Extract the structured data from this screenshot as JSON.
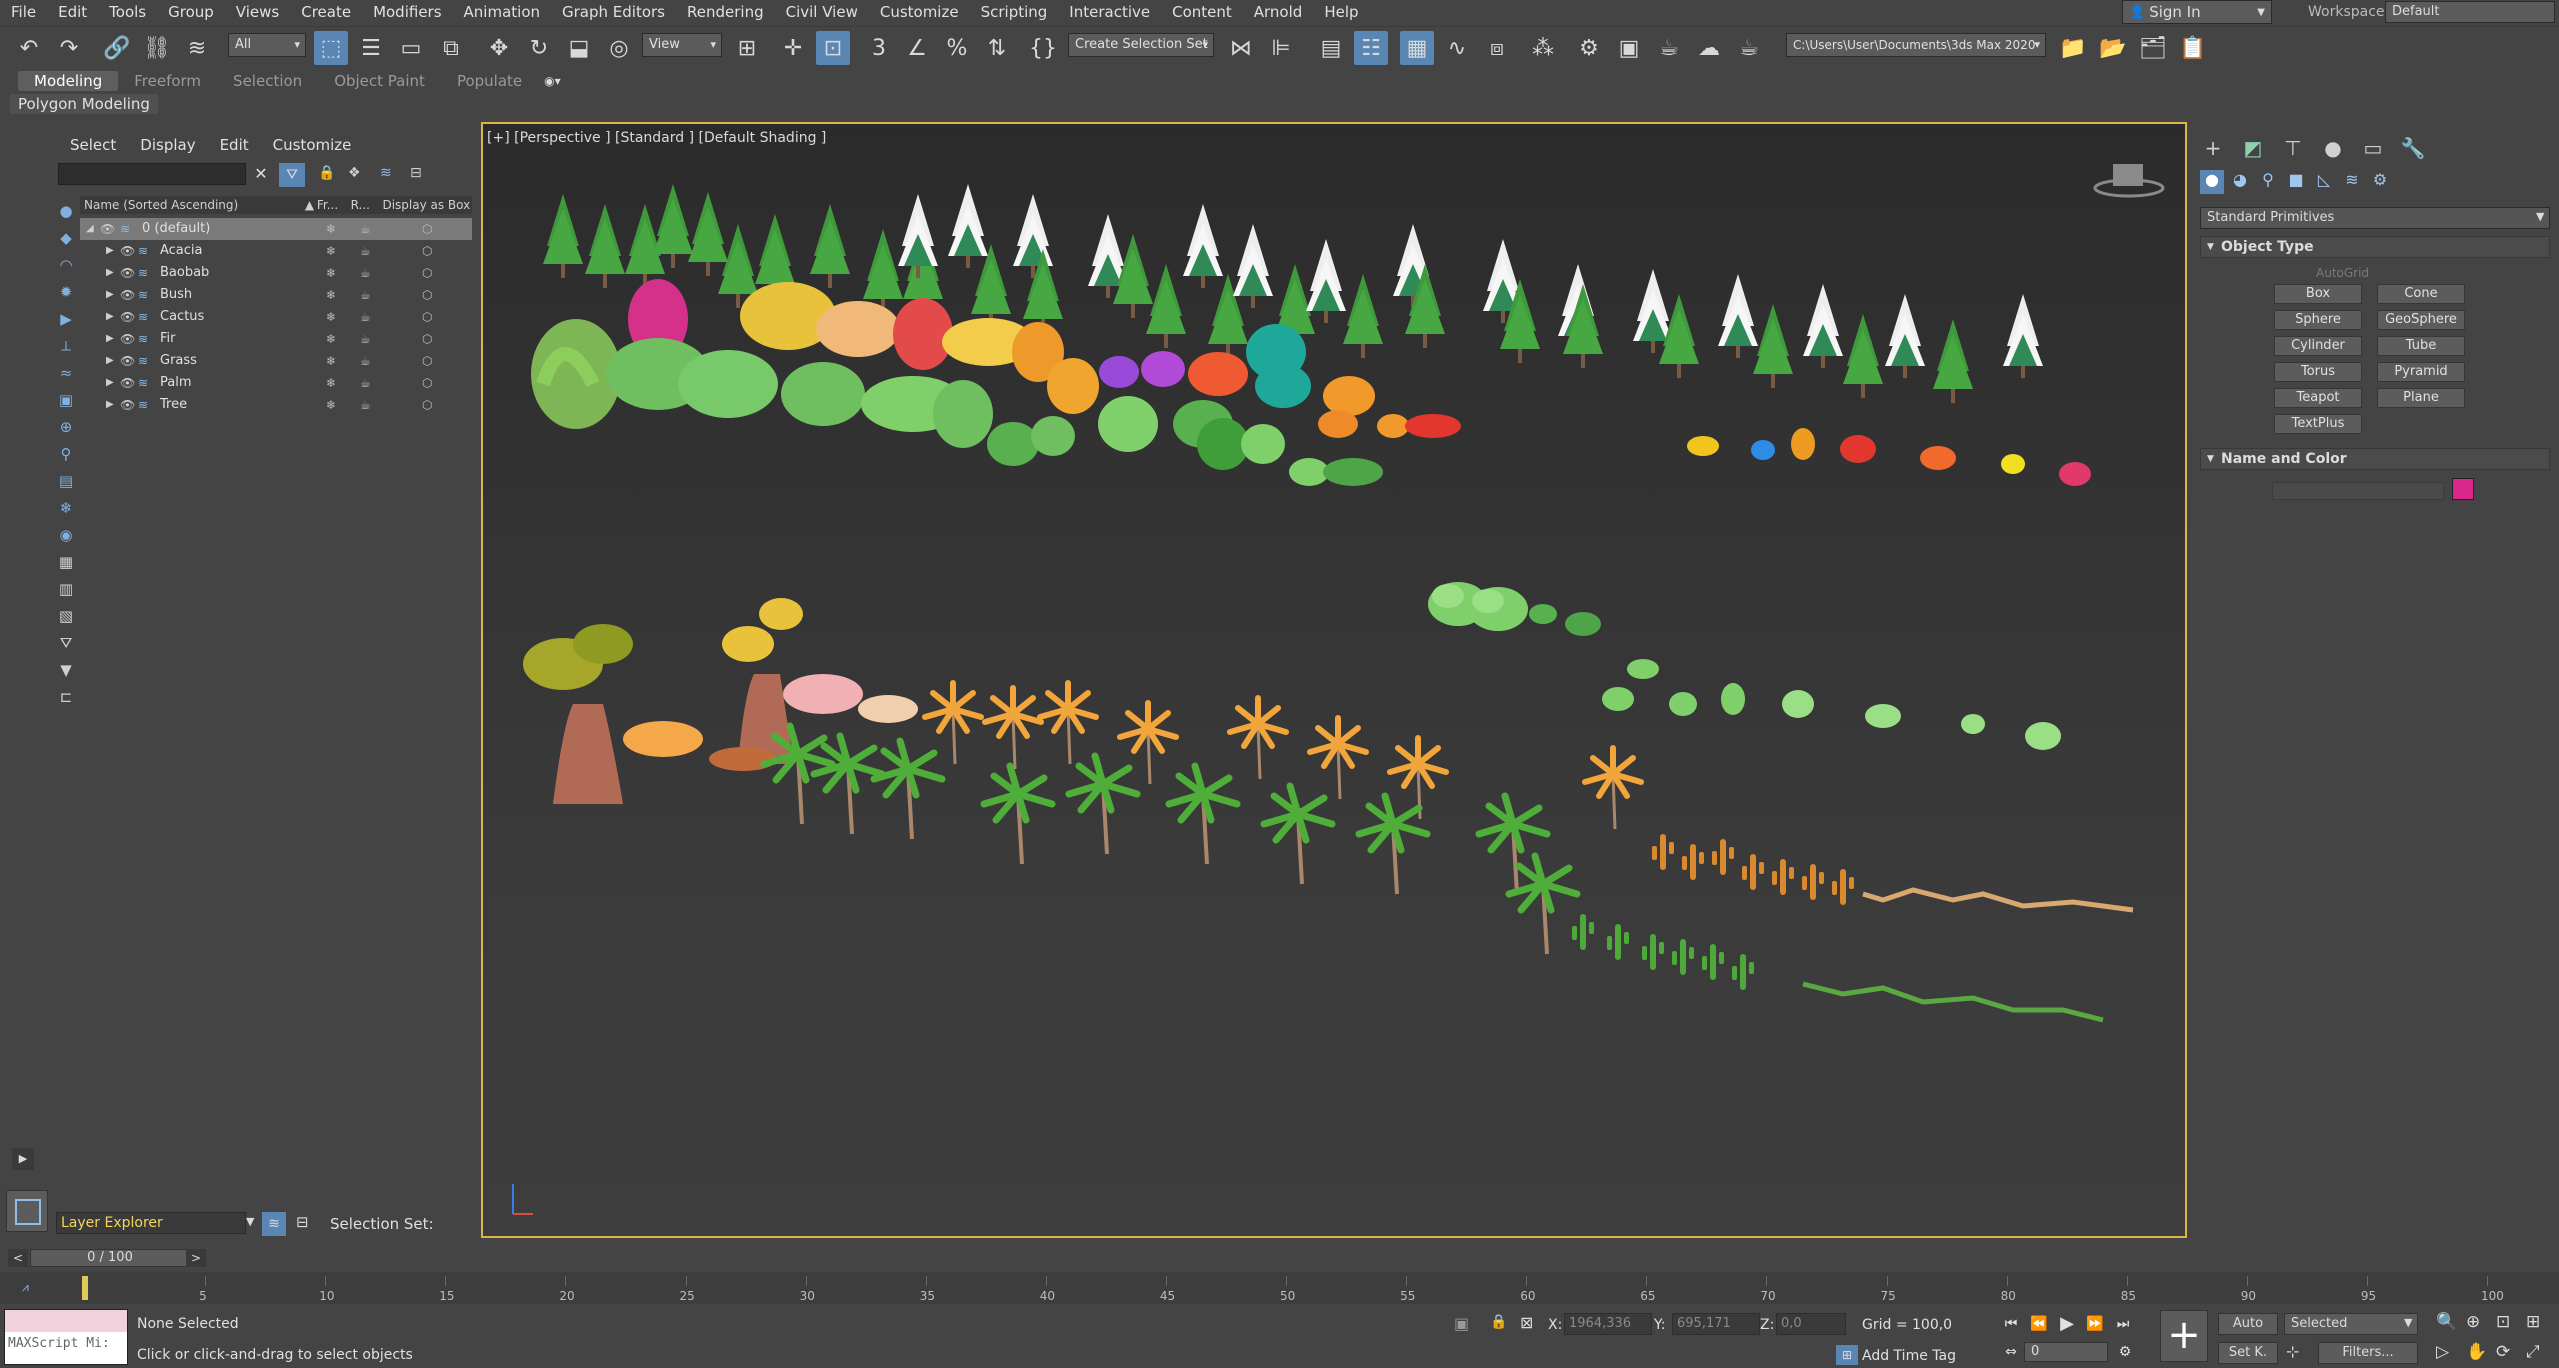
{
  "menu": [
    "File",
    "Edit",
    "Tools",
    "Group",
    "Views",
    "Create",
    "Modifiers",
    "Animation",
    "Graph Editors",
    "Rendering",
    "Civil View",
    "Customize",
    "Scripting",
    "Interactive",
    "Content",
    "Arnold",
    "Help"
  ],
  "account": {
    "sign_in": "Sign In",
    "workspaces_label": "Workspaces:",
    "workspace": "Default"
  },
  "toolbar": {
    "selection_filter": "All",
    "reference_coord": "View",
    "selection_set": "Create Selection Set",
    "project_path": "C:\\Users\\User\\Documents\\3ds Max 2020"
  },
  "ribbon": {
    "tabs": [
      "Modeling",
      "Freeform",
      "Selection",
      "Object Paint",
      "Populate"
    ],
    "active_tab": "Modeling",
    "sub_tab": "Polygon Modeling"
  },
  "explorer": {
    "menu": [
      "Select",
      "Display",
      "Edit",
      "Customize"
    ],
    "columns": {
      "name": "Name (Sorted Ascending)",
      "freeze": "Fr...",
      "render": "R...",
      "box": "Display as Box"
    },
    "root": "0 (default)",
    "layers": [
      "Acacia",
      "Baobab",
      "Bush",
      "Cactus",
      "Fir",
      "Grass",
      "Palm",
      "Tree"
    ],
    "bottom_selector": "Layer Explorer",
    "selection_set_label": "Selection Set:"
  },
  "viewport": {
    "label": "[+] [Perspective ] [Standard ] [Default Shading ]"
  },
  "command_panel": {
    "category": "Standard Primitives",
    "object_type_title": "Object Type",
    "autogrid": "AutoGrid",
    "buttons": [
      "Box",
      "Cone",
      "Sphere",
      "GeoSphere",
      "Cylinder",
      "Tube",
      "Torus",
      "Pyramid",
      "Teapot",
      "Plane",
      "TextPlus"
    ],
    "name_color_title": "Name and Color",
    "swatch_color": "#d9278c"
  },
  "timeline": {
    "frame_display": "0 / 100",
    "ticks": [
      "5",
      "10",
      "15",
      "20",
      "25",
      "30",
      "35",
      "40",
      "45",
      "50",
      "55",
      "60",
      "65",
      "70",
      "75",
      "80",
      "85",
      "90",
      "95",
      "100"
    ]
  },
  "status": {
    "maxscript_label": "MAXScript Mi:",
    "selection": "None Selected",
    "prompt": "Click or click-and-drag to select objects",
    "x_label": "X:",
    "x_value": "1964,336",
    "y_label": "Y:",
    "y_value": "695,171",
    "z_label": "Z:",
    "z_value": "0,0",
    "grid": "Grid = 100,0",
    "add_time_tag": "Add Time Tag",
    "frame_value": "0",
    "auto_label": "Auto",
    "setk_label": "Set K.",
    "key_mode": "Selected",
    "filters_label": "Filters..."
  }
}
